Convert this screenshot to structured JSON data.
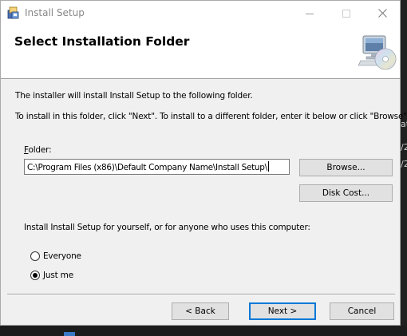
{
  "window": {
    "title": "Install Setup",
    "controls": {
      "minimize_icon": "minimize-icon",
      "maximize_icon": "maximize-icon",
      "close_icon": "close-icon"
    }
  },
  "header": {
    "title": "Select Installation Folder",
    "icon": "computer-cd-icon"
  },
  "body": {
    "intro": "The installer will install Install Setup to the following folder.",
    "instructions": "To install in this folder, click \"Next\". To install to a different folder, enter it below or click \"Browse\".",
    "folder_label": "Folder:",
    "folder_value": "C:\\Program Files (x86)\\Default Company Name\\Install Setup\\",
    "browse_label": "Browse...",
    "disk_cost_label": "Disk Cost...",
    "scope_question": "Install Install Setup for yourself, or for anyone who uses this computer:",
    "options": [
      {
        "label": "Everyone",
        "checked": false
      },
      {
        "label": "Just me",
        "checked": true
      }
    ]
  },
  "footer": {
    "back_label": "< Back",
    "next_label": "Next >",
    "cancel_label": "Cancel"
  },
  "background_fragments": [
    "at",
    "/2",
    "/2"
  ],
  "colors": {
    "accent": "#0078d7",
    "dialog_bg": "#f0f0f0",
    "header_bg": "#ffffff"
  }
}
